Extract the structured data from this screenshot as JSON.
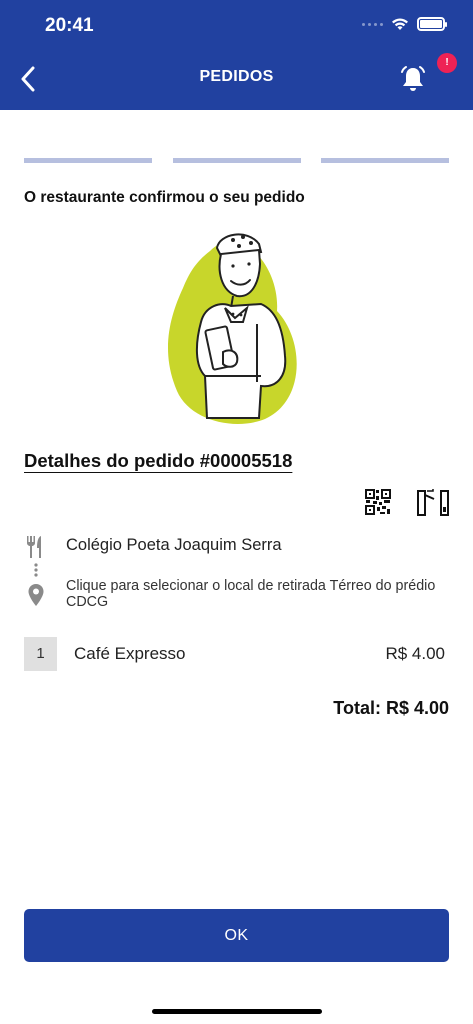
{
  "status_bar": {
    "time": "20:41"
  },
  "header": {
    "title": "PEDIDOS",
    "notification_badge": "!"
  },
  "colors": {
    "brand": "#2141a0",
    "badge": "#ee2255",
    "progress": "#b6bfdf",
    "illustration_blob": "#c8d62b"
  },
  "progress_steps": 3,
  "order": {
    "status_message": "O restaurante confirmou o seu pedido",
    "details_title": "Detalhes do pedido #00005518",
    "restaurant": "Colégio Poeta Joaquim Serra",
    "pickup_text_line1": "Clique para selecionar o local de retirada Térreo do prédio",
    "pickup_text_line2": "CDCG",
    "items": [
      {
        "qty": "1",
        "name": "Café Expresso",
        "price": "R$ 4.00"
      }
    ],
    "total": "Total: R$ 4.00"
  },
  "icons": [
    "back-arrow-icon",
    "bell-icon",
    "qr-code-icon",
    "turnstile-icon",
    "fork-knife-icon",
    "location-pin-icon"
  ],
  "ok_button": "OK"
}
